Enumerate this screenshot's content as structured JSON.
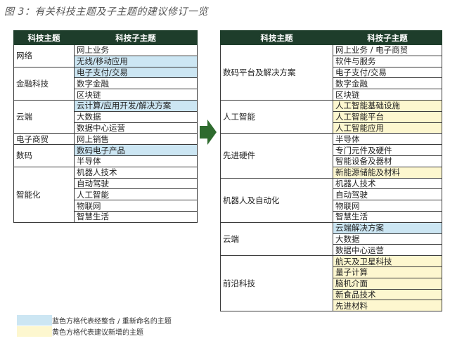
{
  "title": "图 3：有关科技主题及子主题的建议修订一览",
  "headers": {
    "topic": "科技主题",
    "subtopic": "科技子主题"
  },
  "left_groups": [
    {
      "topic": "网络",
      "subs": [
        {
          "label": "网上业务",
          "hl": ""
        },
        {
          "label": "无线/移动应用",
          "hl": "blue"
        }
      ]
    },
    {
      "topic": "金融科技",
      "subs": [
        {
          "label": "电子支付/交易",
          "hl": "blue"
        },
        {
          "label": "数字金融",
          "hl": ""
        },
        {
          "label": "区块链",
          "hl": ""
        }
      ]
    },
    {
      "topic": "云端",
      "subs": [
        {
          "label": "云计算/应用开发/解决方案",
          "hl": "blue"
        },
        {
          "label": "大数据",
          "hl": ""
        },
        {
          "label": "数据中心运营",
          "hl": ""
        }
      ]
    },
    {
      "topic": "电子商贸",
      "subs": [
        {
          "label": "网上销售",
          "hl": ""
        }
      ]
    },
    {
      "topic": "数码",
      "subs": [
        {
          "label": "数码电子产品",
          "hl": "blue"
        },
        {
          "label": "半导体",
          "hl": ""
        }
      ]
    },
    {
      "topic": "智能化",
      "subs": [
        {
          "label": "机器人技术",
          "hl": ""
        },
        {
          "label": "自动驾驶",
          "hl": ""
        },
        {
          "label": "人工智能",
          "hl": ""
        },
        {
          "label": "物联网",
          "hl": ""
        },
        {
          "label": "智慧生活",
          "hl": ""
        }
      ]
    }
  ],
  "right_groups": [
    {
      "topic": "数码平台及解决方案",
      "subs": [
        {
          "label": "网上业务 / 电子商贸",
          "hl": ""
        },
        {
          "label": "软件与服务",
          "hl": ""
        },
        {
          "label": "电子支付/交易",
          "hl": ""
        },
        {
          "label": "数字金融",
          "hl": ""
        },
        {
          "label": "区块链",
          "hl": ""
        }
      ]
    },
    {
      "topic": "人工智能",
      "subs": [
        {
          "label": "人工智能基础设施",
          "hl": "yellow"
        },
        {
          "label": "人工智能平台",
          "hl": "yellow"
        },
        {
          "label": "人工智能应用",
          "hl": "yellow"
        }
      ]
    },
    {
      "topic": "先进硬件",
      "subs": [
        {
          "label": "半导体",
          "hl": ""
        },
        {
          "label": "专门元件及硬件",
          "hl": ""
        },
        {
          "label": "智能设备及器材",
          "hl": ""
        },
        {
          "label": "新能源储能及材料",
          "hl": "yellow"
        }
      ]
    },
    {
      "topic": "机器人及自动化",
      "subs": [
        {
          "label": "机器人技术",
          "hl": ""
        },
        {
          "label": "自动驾驶",
          "hl": ""
        },
        {
          "label": "物联网",
          "hl": ""
        },
        {
          "label": "智慧生活",
          "hl": ""
        }
      ]
    },
    {
      "topic": "云端",
      "subs": [
        {
          "label": "云端解决方案",
          "hl": "blue"
        },
        {
          "label": "大数据",
          "hl": ""
        },
        {
          "label": "数据中心运营",
          "hl": ""
        }
      ]
    },
    {
      "topic": "前沿科技",
      "subs": [
        {
          "label": "航天及卫星科技",
          "hl": "yellow"
        },
        {
          "label": "量子计算",
          "hl": "yellow"
        },
        {
          "label": "脑机介面",
          "hl": "yellow"
        },
        {
          "label": "新食品技术",
          "hl": "yellow"
        },
        {
          "label": "先进材料",
          "hl": "yellow"
        }
      ]
    }
  ],
  "legend": {
    "blue_label": "蓝色方格代表经整合 / 重新命名的主题",
    "yellow_label": "黄色方格代表建议新增的主题"
  },
  "colors": {
    "header": "#1e3d2b",
    "blue": "#cce6f3",
    "yellow": "#fdf7cf",
    "arrow": "#2e6b2e"
  },
  "icons": {
    "arrow": "right-arrow-icon"
  }
}
